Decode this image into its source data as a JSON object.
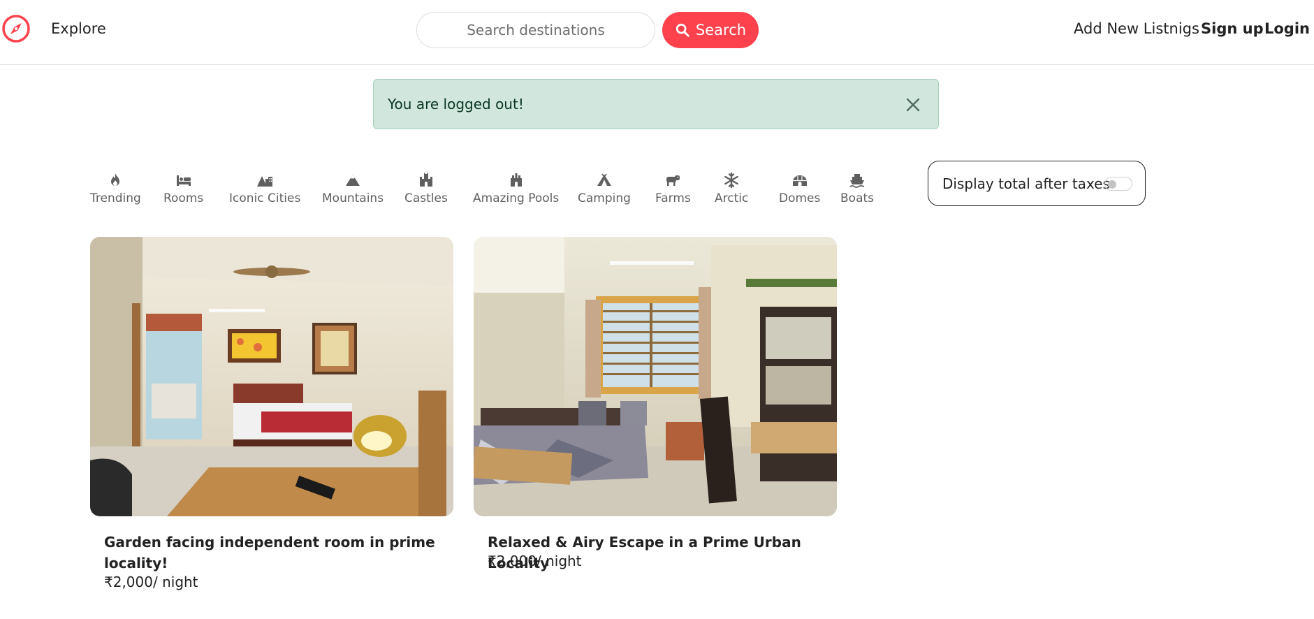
{
  "navbar": {
    "explore": "Explore",
    "search_placeholder": "Search destinations",
    "search_button": "Search",
    "add_listing": "Add New Listnigs",
    "signup": "Sign up",
    "login": "Login"
  },
  "alert": {
    "message": "You are logged out!"
  },
  "filters": [
    {
      "label": "Trending",
      "icon": "fire-icon"
    },
    {
      "label": "Rooms",
      "icon": "bed-icon"
    },
    {
      "label": "Iconic Cities",
      "icon": "mountain-city-icon"
    },
    {
      "label": "Mountains",
      "icon": "mountain-icon"
    },
    {
      "label": "Castles",
      "icon": "castle-icon"
    },
    {
      "label": "Amazing Pools",
      "icon": "person-swimming-icon"
    },
    {
      "label": "Camping",
      "icon": "campground-icon"
    },
    {
      "label": "Farms",
      "icon": "cow-icon"
    },
    {
      "label": "Arctic",
      "icon": "snowflake-icon"
    },
    {
      "label": "Domes",
      "icon": "igloo-icon"
    },
    {
      "label": "Boats",
      "icon": "ship-icon"
    }
  ],
  "tax_toggle": {
    "label": "Display total after taxes",
    "checked": false
  },
  "listings": [
    {
      "title": "Garden facing independent room in prime locality!",
      "price": "₹2,000",
      "per_night": "/ night"
    },
    {
      "title": "Relaxed & Airy Escape in a Prime Urban Locality",
      "price": "₹2,000",
      "per_night": "/ night"
    }
  ],
  "colors": {
    "brand": "#fe424d",
    "alert_bg": "#d1e7dd",
    "alert_text": "#0a3622"
  }
}
